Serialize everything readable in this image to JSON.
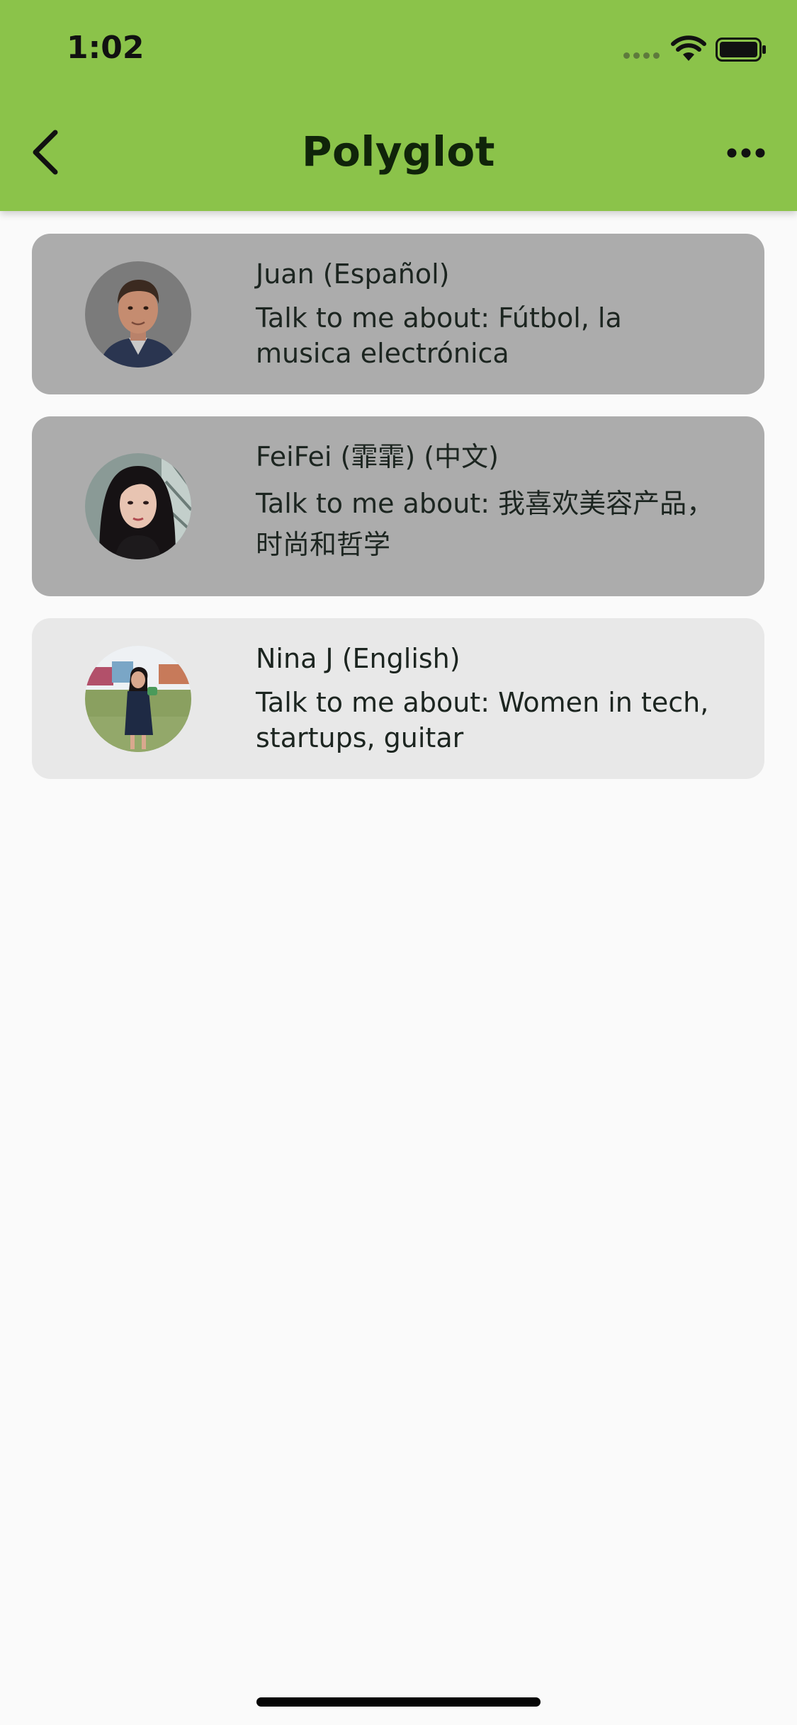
{
  "status_bar": {
    "time": "1:02"
  },
  "toolbar": {
    "title": "Polyglot",
    "back_icon": "chevron-left-icon",
    "more_icon": "more-horizontal-icon"
  },
  "colors": {
    "app_bar": "#8bc34a",
    "card_inactive": "#acacac",
    "card_active": "#e8e8e8",
    "background": "#fafafa"
  },
  "speakers": [
    {
      "name": "Juan (Español)",
      "topics": "Talk to me about: Fútbol, la musica electrónica",
      "avatar": "avatar-photo-man"
    },
    {
      "name": "FeiFei (霏霏) (中文)",
      "topics": "Talk to me about: 我喜欢美容产品，时尚和哲学",
      "avatar": "avatar-photo-woman"
    },
    {
      "name": "Nina J (English)",
      "topics": "Talk to me about: Women in tech, startups, guitar",
      "avatar": "avatar-photo-woman-outdoors"
    }
  ]
}
